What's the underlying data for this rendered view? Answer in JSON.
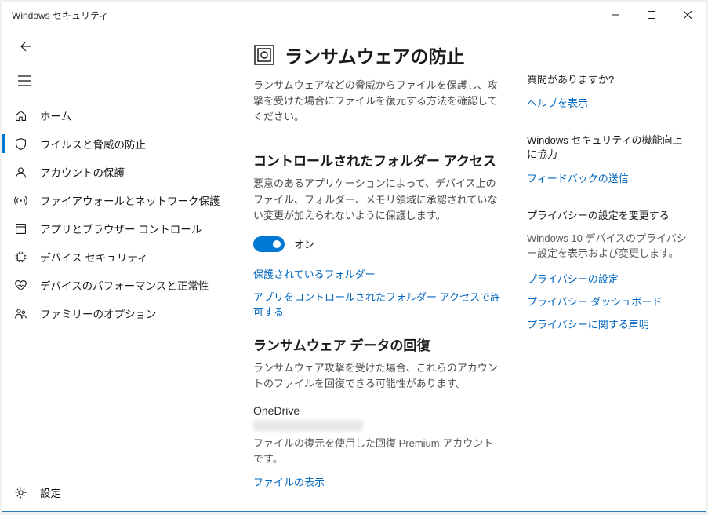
{
  "window": {
    "title": "Windows セキュリティ"
  },
  "sidebar": {
    "items": [
      {
        "label": "ホーム"
      },
      {
        "label": "ウイルスと脅威の防止"
      },
      {
        "label": "アカウントの保護"
      },
      {
        "label": "ファイアウォールとネットワーク保護"
      },
      {
        "label": "アプリとブラウザー コントロール"
      },
      {
        "label": "デバイス セキュリティ"
      },
      {
        "label": "デバイスのパフォーマンスと正常性"
      },
      {
        "label": "ファミリーのオプション"
      }
    ],
    "settings": "設定"
  },
  "main": {
    "title": "ランサムウェアの防止",
    "desc": "ランサムウェアなどの脅威からファイルを保護し、攻撃を受けた場合にファイルを復元する方法を確認してください。",
    "cfa": {
      "title": "コントロールされたフォルダー アクセス",
      "desc": "悪意のあるアプリケーションによって、デバイス上のファイル、フォルダー、メモリ領域に承認されていない変更が加えられないように保護します。",
      "toggle_label": "オン",
      "link_protected": "保護されているフォルダー",
      "link_allow": "アプリをコントロールされたフォルダー アクセスで許可する"
    },
    "recovery": {
      "title": "ランサムウェア データの回復",
      "desc": "ランサムウェア攻撃を受けた場合、これらのアカウントのファイルを回復できる可能性があります。",
      "onedrive_label": "OneDrive",
      "onedrive_desc": "ファイルの復元を使用した回復 Premium アカウントです。",
      "view_files": "ファイルの表示"
    }
  },
  "aside": {
    "help": {
      "title": "質問がありますか?",
      "link": "ヘルプを表示"
    },
    "feedback": {
      "title": "Windows セキュリティの機能向上に協力",
      "link": "フィードバックの送信"
    },
    "privacy": {
      "title": "プライバシーの設定を変更する",
      "desc": "Windows 10 デバイスのプライバシー設定を表示および変更します。",
      "link_settings": "プライバシーの設定",
      "link_dashboard": "プライバシー ダッシュボード",
      "link_statement": "プライバシーに関する声明"
    }
  }
}
